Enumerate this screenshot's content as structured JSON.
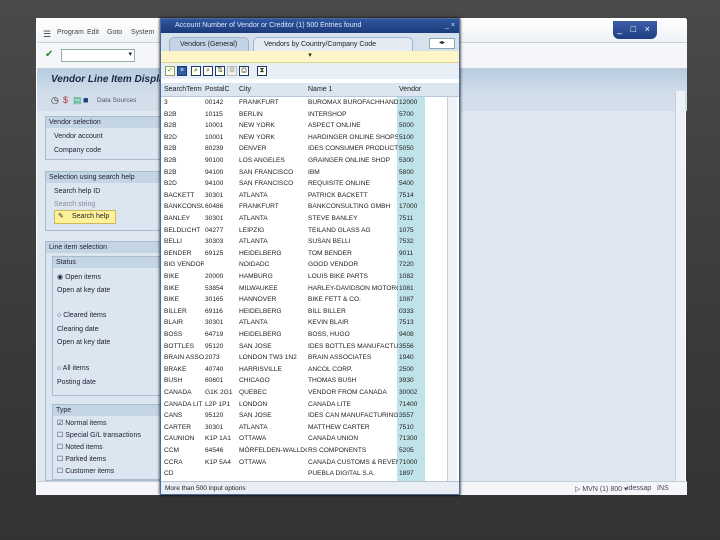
{
  "menu": [
    "Program",
    "Edit",
    "Goto",
    "System"
  ],
  "window_controls": "_ □ ×",
  "command_field": {
    "value": ""
  },
  "main": {
    "title": "Vendor Line Item Display",
    "data_sources": "Data Sources",
    "vendor_selection": {
      "header": "Vendor selection",
      "fields": [
        "Vendor account",
        "Company code"
      ]
    },
    "search_help": {
      "header": "Selection using search help",
      "id_label": "Search help ID",
      "string_label": "Search string",
      "button": "Search help"
    },
    "line_item": {
      "header": "Line item selection",
      "status_header": "Status",
      "open_items": "Open items",
      "open_key_date": "Open at key date",
      "cleared_items": "Cleared items",
      "clearing_date": "Clearing date",
      "cleared_open_key_date": "Open at key date",
      "all_items": "All items",
      "posting_date": "Posting date",
      "type_header": "Type",
      "types": [
        {
          "label": "Normal items",
          "checked": true
        },
        {
          "label": "Special G/L transactions",
          "checked": false
        },
        {
          "label": "Noted items",
          "checked": false
        },
        {
          "label": "Parked items",
          "checked": false
        },
        {
          "label": "Customer items",
          "checked": false
        }
      ]
    }
  },
  "status_bar": {
    "text": "MVN (1) 800",
    "server": "idessap",
    "mode": "INS"
  },
  "popup": {
    "title": "Account Number of Vendor or Creditor (1)  500 Entries found",
    "tabs": [
      "Vendors (General)",
      "Vendors by Country/Company Code"
    ],
    "columns": [
      "SearchTerm",
      "PostalC",
      "City",
      "Name 1",
      "Vendor"
    ],
    "rows": [
      [
        "3",
        "00142",
        "FRANKFURT",
        "BUROMAX BUROFACHHANDEL",
        "12000"
      ],
      [
        "B2B",
        "10115",
        "BERLIN",
        "INTERSHOP",
        "5700"
      ],
      [
        "B2B",
        "10001",
        "NEW YORK",
        "ASPECT ONLINE",
        "5000"
      ],
      [
        "B2D",
        "10001",
        "NEW YORK",
        "HARDINGER ONLINE SHOPS",
        "5100"
      ],
      [
        "B2B",
        "80239",
        "DENVER",
        "IDES CONSUMER PRODUCTS",
        "5050"
      ],
      [
        "B2B",
        "90100",
        "LOS ANGELES",
        "GRAINGER ONLINE SHOP",
        "5300"
      ],
      [
        "B2B",
        "94100",
        "SAN FRANCISCO",
        "IBM",
        "5800"
      ],
      [
        "B2D",
        "94100",
        "SAN FRANCISCO",
        "REQUISITE ONLINE",
        "5400"
      ],
      [
        "BACKETT",
        "30301",
        "ATLANTA",
        "PATRICK BACKETT",
        "7514"
      ],
      [
        "BANKCONSU",
        "60486",
        "FRANKFURT",
        "BANKCONSULTING GMBH",
        "17000"
      ],
      [
        "BANLEY",
        "30301",
        "ATLANTA",
        "STEVE BANLEY",
        "7511"
      ],
      [
        "BELDLICHT",
        "04277",
        "LEIPZIG",
        "TEILAND GLASS AG",
        "1075"
      ],
      [
        "BELLI",
        "30303",
        "ATLANTA",
        "SUSAN BELLI",
        "7532"
      ],
      [
        "BENDER",
        "69125",
        "HEIDELBERG",
        "TOM BENDER",
        "9011"
      ],
      [
        "BIG VENDOR",
        "",
        "NOIDADC",
        "GOOD VENDOR",
        "7220"
      ],
      [
        "BIKE",
        "20000",
        "HAMBURG",
        "LOUIS BIKE PARTS",
        "1082"
      ],
      [
        "BIKE",
        "53854",
        "MILWAUKEE",
        "HARLEY-DAVIDSON MOTORCYCL",
        "1081"
      ],
      [
        "BIKE",
        "30165",
        "HANNOVER",
        "BIKE FETT & CO.",
        "1087"
      ],
      [
        "BILLER",
        "69116",
        "HEIDELBERG",
        "BILL BILLER",
        "0333"
      ],
      [
        "BLAIR",
        "30301",
        "ATLANTA",
        "KEVIN BLAIR",
        "7513"
      ],
      [
        "BOSS",
        "64719",
        "HEIDELBERG",
        "BOSS, HUGO",
        "9408"
      ],
      [
        "BOTTLES",
        "95120",
        "SAN JOSE",
        "IDES BOTTLES MANUFACTURIN",
        "3556"
      ],
      [
        "BRAIN ASSO",
        "2073",
        "LONDON TW3 1N2",
        "BRAIN ASSOCIATES",
        "1940"
      ],
      [
        "BRAKE",
        "40740",
        "HARRISVILLE",
        "ANCOL CORP.",
        "2500"
      ],
      [
        "BUSH",
        "60601",
        "CHICAGO",
        "THOMAS BUSH",
        "3930"
      ],
      [
        "CANADA",
        "G1K 2G1",
        "QUEBEC",
        "VENDOR FROM CANADA",
        "30002"
      ],
      [
        "CANADA LIT",
        "L2P 1P1",
        "LONDON",
        "CANADA LITE",
        "71400"
      ],
      [
        "CANS",
        "95120",
        "SAN JOSE",
        "IDES CAN MANUFACTURING",
        "3557"
      ],
      [
        "CARTER",
        "30301",
        "ATLANTA",
        "MATTHEW CARTER",
        "7510"
      ],
      [
        "CAUNION",
        "K1P 1A1",
        "OTTAWA",
        "CANADA UNION",
        "71300"
      ],
      [
        "CCM",
        "64546",
        "MÖRFELDEN-WALLDORF",
        "RS COMPONENTS",
        "5205"
      ],
      [
        "CCRA",
        "K1P 5A4",
        "OTTAWA",
        "CANADA CUSTOMS & REVENUE",
        "71000"
      ],
      [
        "CD",
        "",
        "",
        "PUEBLA DIGITAL S.A.",
        "1897"
      ]
    ],
    "status": "More than 500 input options"
  },
  "colors": {
    "title_bar": "#1b3a7a",
    "vendor_column": "#bfe3e8",
    "search_help_button": "#fdf19a"
  }
}
